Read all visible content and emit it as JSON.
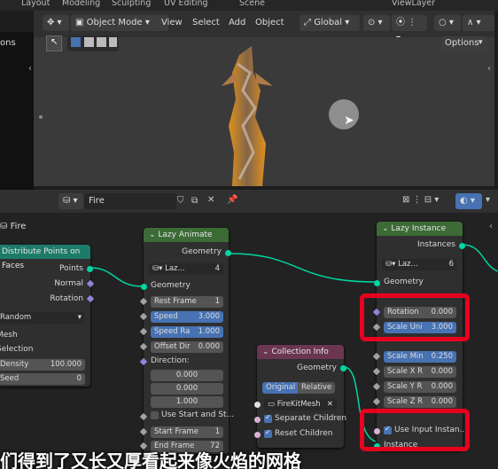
{
  "workspace_tabs": [
    "Layout",
    "Modeling",
    "Sculpting",
    "UV Editing",
    "Scene",
    "ViewLayer"
  ],
  "viewport": {
    "mode": "Object Mode",
    "menus": [
      "View",
      "Select",
      "Add",
      "Object"
    ],
    "orientation": "Global",
    "left_options": "ons",
    "options": "Options"
  },
  "node_editor": {
    "tree_name": "Fire",
    "breadcrumb": "Fire"
  },
  "nodes": {
    "distribute": {
      "title": "Distribute Points on Faces",
      "outputs": [
        "Points",
        "Normal",
        "Rotation"
      ],
      "mode": "Random",
      "inputs": [
        "Mesh",
        "Selection"
      ],
      "density_label": "Density",
      "density_value": "100.000",
      "seed_label": "Seed",
      "seed_value": "0"
    },
    "lazy_animate": {
      "title": "Lazy Animate",
      "output": "Geometry",
      "preset": "Laz...",
      "preset_count": "4",
      "geometry": "Geometry",
      "rest_frame_label": "Rest Frame",
      "rest_frame_value": "1",
      "speed_label": "Speed",
      "speed_value": "3.000",
      "speed_ra_label": "Speed Ra",
      "speed_ra_value": "1.000",
      "offset_dir_label": "Offset Dir",
      "offset_dir_value": "0.000",
      "direction_label": "Direction:",
      "direction_values": [
        "0.000",
        "0.000",
        "1.000"
      ],
      "use_start": "Use Start and St...",
      "start_frame_label": "Start Frame",
      "start_frame_value": "1",
      "end_frame_label": "End Frame",
      "end_frame_value": "72"
    },
    "lazy_instance": {
      "title": "Lazy Instance",
      "output": "Instances",
      "preset": "Laz...",
      "preset_count": "6",
      "geometry": "Geometry",
      "rotation_label": "Rotation",
      "rotation_value": "0.000",
      "scale_uni_label": "Scale Uni",
      "scale_uni_value": "3.000",
      "scale_min_label": "Scale Min",
      "scale_min_value": "0.250",
      "scale_x_label": "Scale X R",
      "scale_x_value": "0.000",
      "scale_y_label": "Scale Y R",
      "scale_y_value": "0.000",
      "scale_z_label": "Scale Z R",
      "scale_z_value": "0.000",
      "use_input": "Use Input Instan...",
      "instance": "Instance"
    },
    "collection_info": {
      "title": "Collection Info",
      "output": "Geometry",
      "mode_original": "Original",
      "mode_relative": "Relative",
      "collection": "FireKitMesh",
      "separate": "Separate Children",
      "reset": "Reset Children"
    }
  },
  "subtitle": "们得到了又长又厚看起来像火焰的网格",
  "colors": {
    "geometry_header": "#1d7b69",
    "collection_header": "#6b3650",
    "group_header": "#3c6b36",
    "highlight": "#e8001f"
  }
}
